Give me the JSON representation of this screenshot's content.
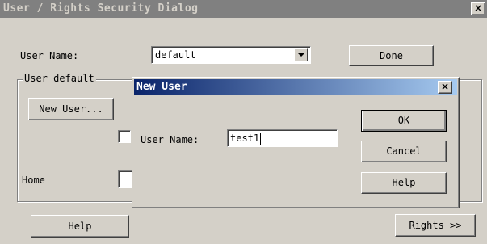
{
  "main_window": {
    "title": "User / Rights Security Dialog",
    "close_glyph": "×",
    "user_name_label": "User Name:",
    "user_name_value": "default",
    "done_label": "Done",
    "group_label": "User default",
    "new_user_label": "New User...",
    "home_label": "Home",
    "help_label": "Help",
    "rights_label": "Rights >>"
  },
  "new_user_dialog": {
    "title": "New User",
    "close_glyph": "×",
    "user_name_label": "User Name:",
    "user_name_value": "test1",
    "ok_label": "OK",
    "cancel_label": "Cancel",
    "help_label": "Help"
  },
  "colors": {
    "face": "#d4d0c8",
    "inactive_title": "#808080",
    "active_title_start": "#0a246a",
    "active_title_end": "#a6caf0"
  },
  "icons": [
    "close-icon",
    "dropdown-arrow-icon"
  ]
}
